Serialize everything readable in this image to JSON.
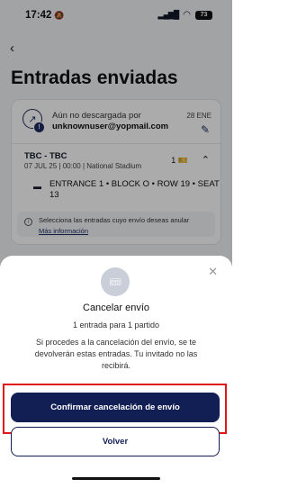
{
  "status_bar": {
    "time": "17:42",
    "battery": "73"
  },
  "header": {
    "back_icon": "chevron-left-icon",
    "title": "Entradas enviadas"
  },
  "card": {
    "status": "Aún no descargada por",
    "email": "unknownuser@yopmail.com",
    "date": "28 ENE",
    "match": "TBC - TBC",
    "match_info": "07 JUL 25 | 00:00 | National Stadium",
    "ticket_count": "1",
    "entry_line1": "ENTRANCE 1 • BLOCK O • ROW 19 • SEAT",
    "entry_line2": "13",
    "notice": "Selecciona las entradas cuyo envío deseas anular",
    "notice_link": "Más información"
  },
  "sheet": {
    "title": "Cancelar envío",
    "subtitle": "1 entrada para 1 partido",
    "description": "Si procedes a la cancelación del envío, se te devolverán estas entradas. Tu invitado no las recibirá.",
    "confirm_label": "Confirmar cancelación de envío",
    "back_label": "Volver"
  },
  "colors": {
    "primary": "#121f54",
    "highlight": "#e01818"
  }
}
